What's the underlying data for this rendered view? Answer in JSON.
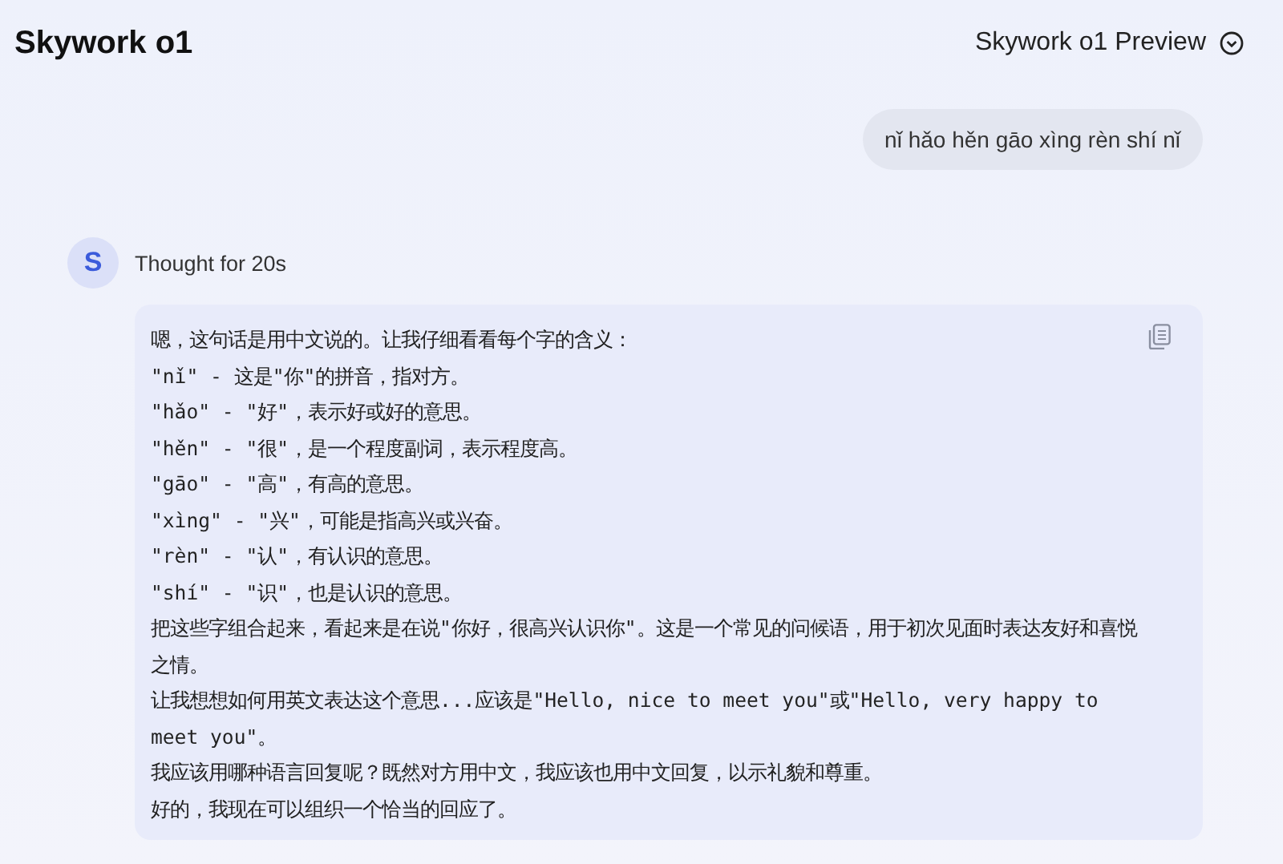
{
  "header": {
    "title": "Skywork o1",
    "model_selector": "Skywork o1 Preview"
  },
  "user_message": "nǐ hǎo hěn gāo xìng rèn shí nǐ",
  "assistant": {
    "avatar": "S",
    "status": "Thought for 20s",
    "thought_lines": [
      "嗯，这句话是用中文说的。让我仔细看看每个字的含义：",
      "\"nǐ\" - 这是\"你\"的拼音，指对方。",
      "\"hǎo\" - \"好\"，表示好或好的意思。",
      "\"hěn\" - \"很\"，是一个程度副词，表示程度高。",
      "\"gāo\" - \"高\"，有高的意思。",
      "\"xìng\" - \"兴\"，可能是指高兴或兴奋。",
      "\"rèn\" - \"认\"，有认识的意思。",
      "\"shí\" - \"识\"，也是认识的意思。",
      "把这些字组合起来，看起来是在说\"你好，很高兴认识你\"。这是一个常见的问候语，用于初次见面时表达友好和喜悦之情。",
      "让我想想如何用英文表达这个意思...应该是\"Hello, nice to meet you\"或\"Hello, very happy to meet you\"。",
      "我应该用哪种语言回复呢？既然对方用中文，我应该也用中文回复，以示礼貌和尊重。",
      "好的，我现在可以组织一个恰当的回应了。"
    ]
  }
}
